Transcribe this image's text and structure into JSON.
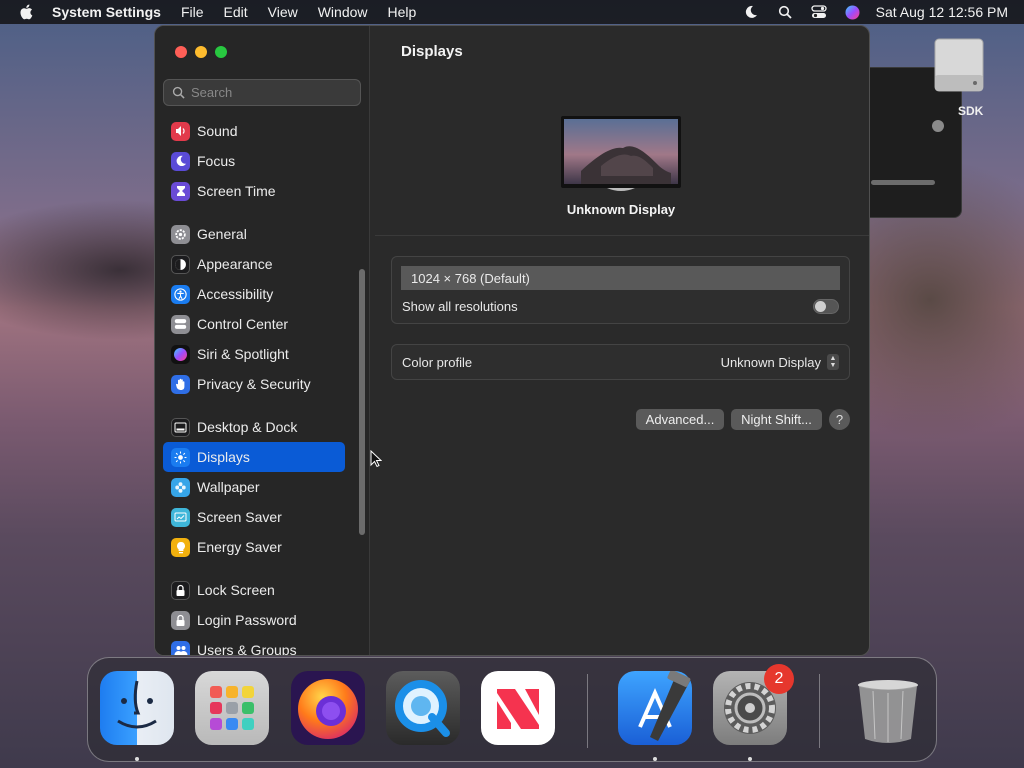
{
  "menubar": {
    "app_name": "System Settings",
    "menus": [
      "File",
      "Edit",
      "View",
      "Window",
      "Help"
    ],
    "clock": "Sat Aug 12  12:56 PM",
    "status_icons": [
      "moon-icon",
      "search-icon",
      "control-center-icon",
      "siri-icon"
    ]
  },
  "desktop": {
    "drive_label": "SDK"
  },
  "window": {
    "search_placeholder": "Search",
    "sidebar": [
      {
        "label": "Sound",
        "icon": "sound-icon",
        "color": "#e23a4b"
      },
      {
        "label": "Focus",
        "icon": "moon-icon",
        "color": "#5a4bd6"
      },
      {
        "label": "Screen Time",
        "icon": "hourglass-icon",
        "color": "#6a4bd6"
      },
      {
        "label": "General",
        "icon": "gear-icon",
        "color": "#8e8e93"
      },
      {
        "label": "Appearance",
        "icon": "appearance-icon",
        "color": "#1c1c1e"
      },
      {
        "label": "Accessibility",
        "icon": "accessibility-icon",
        "color": "#1a7cf0"
      },
      {
        "label": "Control Center",
        "icon": "control-center-icon",
        "color": "#8e8e93"
      },
      {
        "label": "Siri & Spotlight",
        "icon": "siri-icon",
        "color": "#c04ad6"
      },
      {
        "label": "Privacy & Security",
        "icon": "hand-icon",
        "color": "#2f6ee6"
      },
      {
        "label": "Desktop & Dock",
        "icon": "dock-icon",
        "color": "#1c1c1e"
      },
      {
        "label": "Displays",
        "icon": "sun-icon",
        "color": "#1a7cf0"
      },
      {
        "label": "Wallpaper",
        "icon": "flower-icon",
        "color": "#36a5e8"
      },
      {
        "label": "Screen Saver",
        "icon": "screen-saver-icon",
        "color": "#3fb6d9"
      },
      {
        "label": "Energy Saver",
        "icon": "bulb-icon",
        "color": "#f2b10e"
      },
      {
        "label": "Lock Screen",
        "icon": "lock-icon",
        "color": "#1c1c1e"
      },
      {
        "label": "Login Password",
        "icon": "lock-icon",
        "color": "#8e8e93"
      },
      {
        "label": "Users & Groups",
        "icon": "users-icon",
        "color": "#2f6ee6"
      }
    ],
    "selected": "Displays"
  },
  "content": {
    "title": "Displays",
    "display_name": "Unknown Display",
    "resolution": "1024 × 768 (Default)",
    "show_all_label": "Show all resolutions",
    "show_all_on": false,
    "color_profile_label": "Color profile",
    "color_profile_value": "Unknown Display",
    "advanced_button": "Advanced...",
    "night_shift_button": "Night Shift...",
    "help_button": "?"
  },
  "dock": {
    "apps": [
      "Finder",
      "Launchpad",
      "Firefox",
      "QuickTime Player",
      "News",
      "Xcode",
      "System Settings",
      "Trash"
    ],
    "settings_badge": "2"
  }
}
